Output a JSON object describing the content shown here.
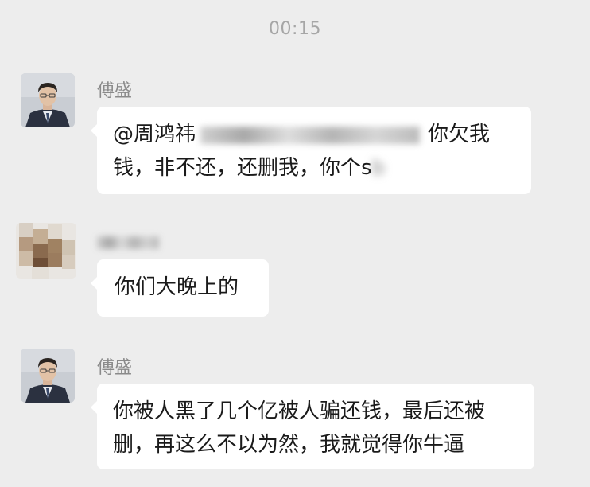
{
  "chat": {
    "timestamp": "00:15",
    "messages": [
      {
        "sender": "傅盛",
        "avatar_icon": "person-in-suit-avatar",
        "mention": "@周鸿祎",
        "line1_end": "你欠我",
        "line2": "钱，非不还，还删我，你个s",
        "line2_blurred_tail": "b"
      },
      {
        "sender": "",
        "avatar_icon": "blurred-avatar",
        "text": "你们大晚上的"
      },
      {
        "sender": "傅盛",
        "avatar_icon": "person-in-suit-avatar",
        "line1": "你被人黑了几个亿被人骗还钱，最后还被",
        "line2": "删，再这么不以为然，我就觉得你牛逼"
      }
    ]
  },
  "colors": {
    "background": "#ededed",
    "bubble": "#ffffff",
    "timestamp": "#a6a6a6",
    "sender": "#8a8a8a",
    "text": "#1a1a1a"
  }
}
